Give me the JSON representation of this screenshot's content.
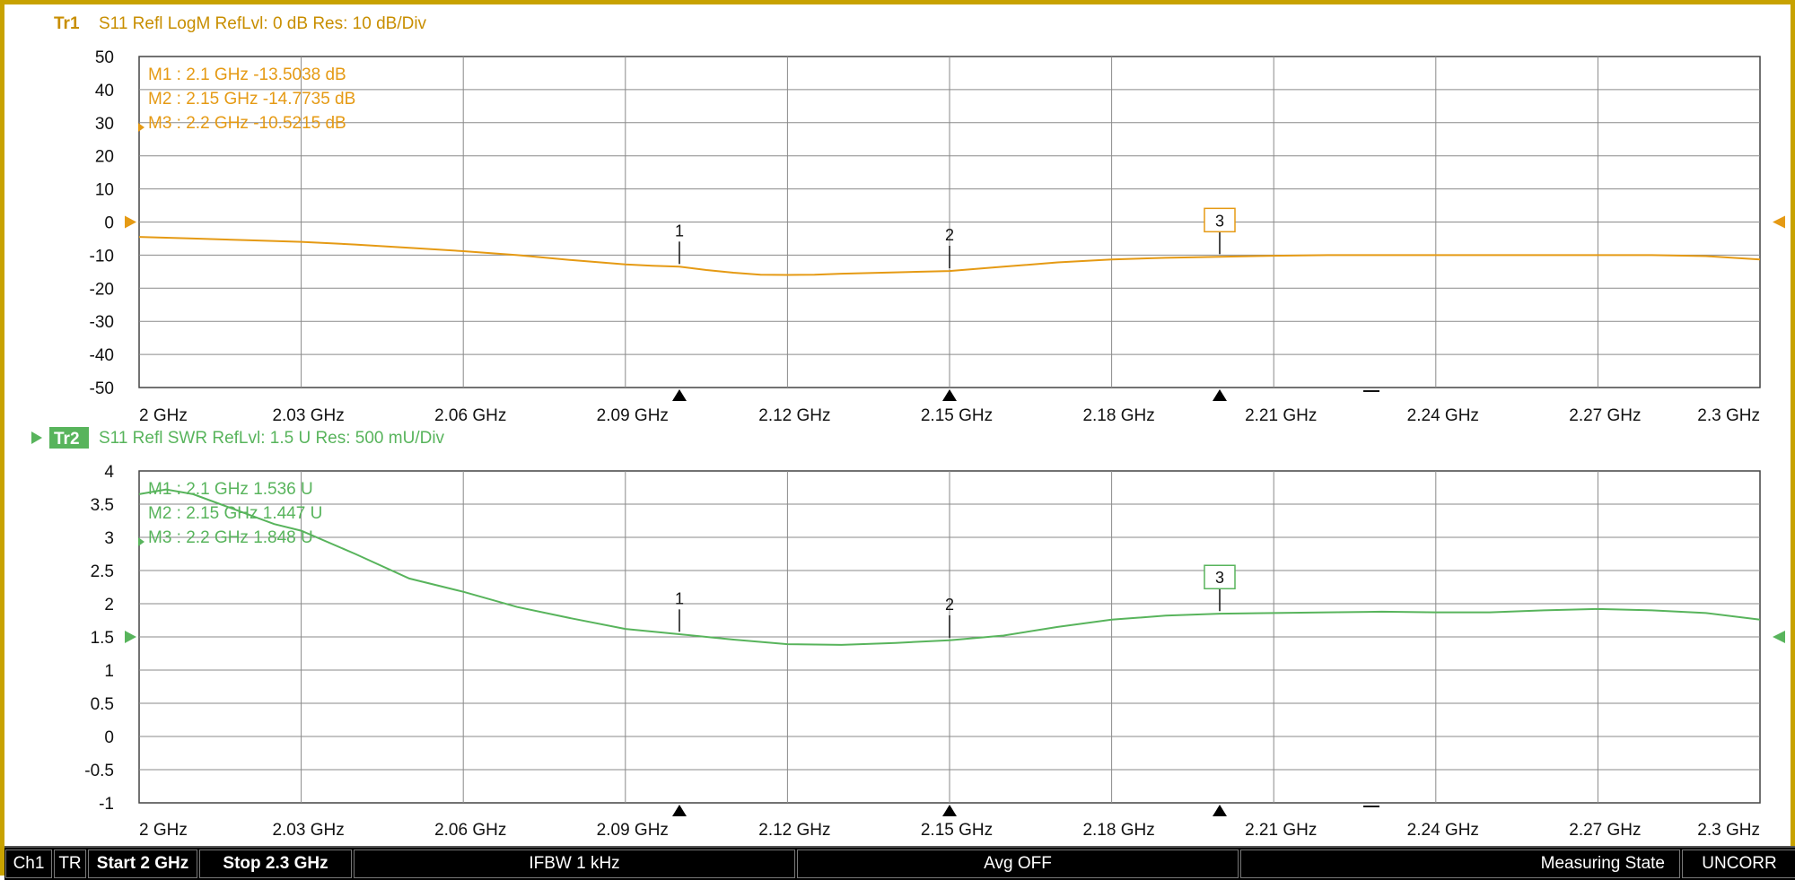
{
  "colors": {
    "trace1": "#e59a14",
    "trace2": "#58b45c",
    "trace1_header": "#c88e00",
    "grid": "#8a8a8a",
    "axis_text": "#111111",
    "frame": "#c8a200"
  },
  "traces": [
    {
      "id": "Tr1",
      "header": "S11  Refl  LogM  RefLvl: 0  dB  Res: 10  dB/Div",
      "y_ticks": [
        "50",
        "40",
        "30",
        "20",
        "10",
        "0",
        "-10",
        "-20",
        "-30",
        "-40",
        "-50"
      ],
      "x_ticks": [
        "2 GHz",
        "2.03 GHz",
        "2.06 GHz",
        "2.09 GHz",
        "2.12 GHz",
        "2.15 GHz",
        "2.18 GHz",
        "2.21 GHz",
        "2.24 GHz",
        "2.27 GHz",
        "2.3 GHz"
      ],
      "markers": [
        {
          "label": "M1 :  2.1 GHz  -13.5038  dB",
          "id": "1",
          "x": 2.1,
          "y": -13.5038
        },
        {
          "label": "M2 :  2.15 GHz  -14.7735  dB",
          "id": "2",
          "x": 2.15,
          "y": -14.7735
        },
        {
          "label": "M3 :  2.2 GHz  -10.5215  dB",
          "id": "3",
          "x": 2.2,
          "y": -10.5215
        }
      ]
    },
    {
      "id": "Tr2",
      "header": "S11  Refl  SWR  RefLvl: 1.5  U  Res: 500  mU/Div",
      "y_ticks": [
        "4",
        "3.5",
        "3",
        "2.5",
        "2",
        "1.5",
        "1",
        "0.5",
        "0",
        "-0.5",
        "-1"
      ],
      "x_ticks": [
        "2 GHz",
        "2.03 GHz",
        "2.06 GHz",
        "2.09 GHz",
        "2.12 GHz",
        "2.15 GHz",
        "2.18 GHz",
        "2.21 GHz",
        "2.24 GHz",
        "2.27 GHz",
        "2.3 GHz"
      ],
      "markers": [
        {
          "label": "M1 :  2.1 GHz  1.536  U",
          "id": "1",
          "x": 2.1,
          "y": 1.536
        },
        {
          "label": "M2 :  2.15 GHz  1.447  U",
          "id": "2",
          "x": 2.15,
          "y": 1.447
        },
        {
          "label": "M3 :  2.2 GHz  1.848  U",
          "id": "3",
          "x": 2.2,
          "y": 1.848
        }
      ]
    }
  ],
  "chart_data": [
    {
      "type": "line",
      "title": "S11  Refl  LogM  RefLvl: 0  dB  Res: 10  dB/Div",
      "xlabel": "",
      "ylabel": "",
      "xlim": [
        2.0,
        2.3
      ],
      "ylim": [
        -50,
        50
      ],
      "grid": true,
      "series": [
        {
          "name": "Tr1",
          "x": [
            2.0,
            2.01,
            2.02,
            2.03,
            2.04,
            2.05,
            2.06,
            2.07,
            2.08,
            2.09,
            2.095,
            2.1,
            2.105,
            2.11,
            2.115,
            2.12,
            2.125,
            2.13,
            2.14,
            2.15,
            2.16,
            2.17,
            2.18,
            2.19,
            2.2,
            2.21,
            2.22,
            2.23,
            2.24,
            2.25,
            2.26,
            2.27,
            2.28,
            2.29,
            2.3
          ],
          "y": [
            -4.5,
            -5.0,
            -5.5,
            -6.0,
            -6.8,
            -7.8,
            -8.8,
            -10.0,
            -11.5,
            -12.8,
            -13.2,
            -13.5,
            -14.5,
            -15.3,
            -15.9,
            -16.0,
            -15.9,
            -15.6,
            -15.2,
            -14.8,
            -13.5,
            -12.2,
            -11.3,
            -10.8,
            -10.5,
            -10.2,
            -10.0,
            -10.0,
            -10.0,
            -10.0,
            -10.0,
            -10.0,
            -10.0,
            -10.3,
            -11.3
          ]
        }
      ]
    },
    {
      "type": "line",
      "title": "S11  Refl  SWR  RefLvl: 1.5  U  Res: 500  mU/Div",
      "xlabel": "",
      "ylabel": "",
      "xlim": [
        2.0,
        2.3
      ],
      "ylim": [
        -1,
        4
      ],
      "grid": true,
      "series": [
        {
          "name": "Tr2",
          "x": [
            2.0,
            2.005,
            2.01,
            2.015,
            2.02,
            2.025,
            2.03,
            2.04,
            2.05,
            2.06,
            2.07,
            2.08,
            2.09,
            2.1,
            2.11,
            2.12,
            2.13,
            2.14,
            2.15,
            2.16,
            2.17,
            2.18,
            2.19,
            2.2,
            2.21,
            2.22,
            2.23,
            2.24,
            2.25,
            2.26,
            2.27,
            2.28,
            2.29,
            2.3
          ],
          "y": [
            3.65,
            3.72,
            3.65,
            3.5,
            3.35,
            3.2,
            3.1,
            2.75,
            2.38,
            2.18,
            1.95,
            1.78,
            1.62,
            1.54,
            1.46,
            1.39,
            1.38,
            1.41,
            1.45,
            1.52,
            1.65,
            1.76,
            1.82,
            1.85,
            1.86,
            1.87,
            1.88,
            1.87,
            1.87,
            1.9,
            1.92,
            1.9,
            1.86,
            1.76
          ]
        }
      ]
    }
  ],
  "status_bar": {
    "channel": "Ch1",
    "mode": "TR",
    "start": "Start 2 GHz",
    "stop": "Stop 2.3 GHz",
    "ifbw": "IFBW 1 kHz",
    "avg": "Avg OFF",
    "state": "Measuring State",
    "cal": "UNCORR"
  }
}
